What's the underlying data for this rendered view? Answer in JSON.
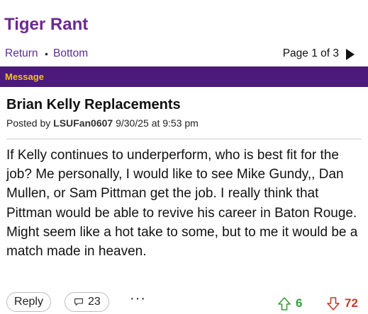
{
  "header": {
    "board_title": "Tiger Rant"
  },
  "nav": {
    "return_label": "Return",
    "separator": "•",
    "bottom_label": "Bottom",
    "page_indicator": "Page 1 of 3"
  },
  "section_bar": {
    "label": "Message"
  },
  "post": {
    "title": "Brian Kelly Replacements",
    "posted_by_prefix": "Posted by",
    "author": "LSUFan0607",
    "timestamp": "9/30/25 at 9:53 pm",
    "body": "If Kelly continues to underperform, who is best fit for the job? Me personally, I would like to see Mike Gundy,, Dan Mullen, or Sam Pittman get the job. I really think that Pittman would be able to revive his career in Baton Rouge. Might seem like a hot take to some, but to me it would be a match made in heaven."
  },
  "actions": {
    "reply_label": "Reply",
    "comment_count": "23",
    "more_label": "···",
    "upvotes": "6",
    "downvotes": "72"
  },
  "colors": {
    "brand_purple": "#4b1a7a",
    "title_purple": "#6b2a8f",
    "bar_text_gold": "#f2c318",
    "upvote_green": "#3a9a3a",
    "downvote_red": "#c23a2a"
  },
  "icons": [
    "next-page-arrow-icon",
    "comment-bubble-icon",
    "more-options-icon",
    "thumbs-up-arrow-icon",
    "thumbs-down-arrow-icon"
  ]
}
